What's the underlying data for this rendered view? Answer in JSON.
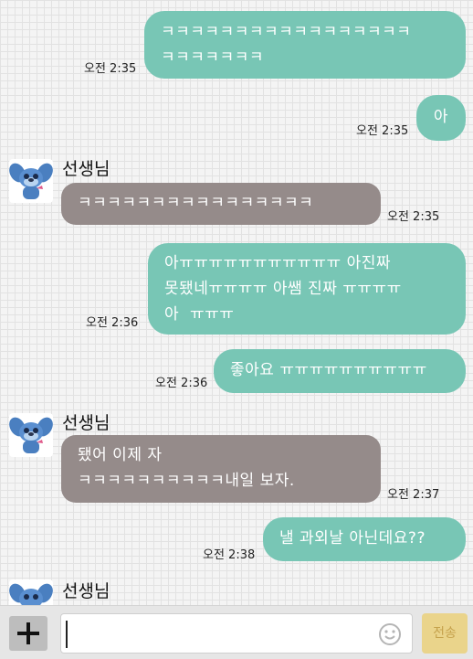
{
  "messages": [
    {
      "side": "me",
      "text": "ㅋㅋㅋㅋㅋㅋㅋㅋㅋㅋㅋㅋㅋㅋㅋㅋㅋ\nㅋㅋㅋㅋㅋㅋㅋ",
      "time": "오전 2:35"
    },
    {
      "side": "me",
      "text": "아",
      "time": "오전 2:35"
    },
    {
      "side": "them",
      "sender": "선생님",
      "text": "ㅋㅋㅋㅋㅋㅋㅋㅋㅋㅋㅋㅋㅋㅋㅋㅋ",
      "time": "오전 2:35"
    },
    {
      "side": "me",
      "text": "아ㅠㅠㅠㅠㅠㅠㅠㅠㅠㅠㅠ 아진짜\n못됐네ㅠㅠㅠㅠ 아쌤 진짜 ㅠㅠㅠㅠ\n아  ㅠㅠㅠ",
      "time": "오전 2:36"
    },
    {
      "side": "me",
      "text": "좋아요 ㅠㅠㅠㅠㅠㅠㅠㅠㅠㅠ",
      "time": "오전 2:36"
    },
    {
      "side": "them",
      "sender": "선생님",
      "text": "됐어 이제 자\nㅋㅋㅋㅋㅋㅋㅋㅋㅋㅋ내일 보자.",
      "time": "오전 2:37"
    },
    {
      "side": "me",
      "text": "낼 과외날 아닌데요??",
      "time": "오전 2:38"
    },
    {
      "side": "them",
      "sender": "선생님",
      "text": "",
      "time": ""
    }
  ],
  "input": {
    "placeholder": "",
    "plus_label": "+",
    "send_label": "전송"
  },
  "colors": {
    "my_bubble": "#78c6b5",
    "their_bubble": "#958b8a",
    "send_button": "#ead48b"
  },
  "icons": {
    "plus": "plus-icon",
    "emoji": "smiley-icon",
    "avatar": "stitch-character-avatar"
  }
}
